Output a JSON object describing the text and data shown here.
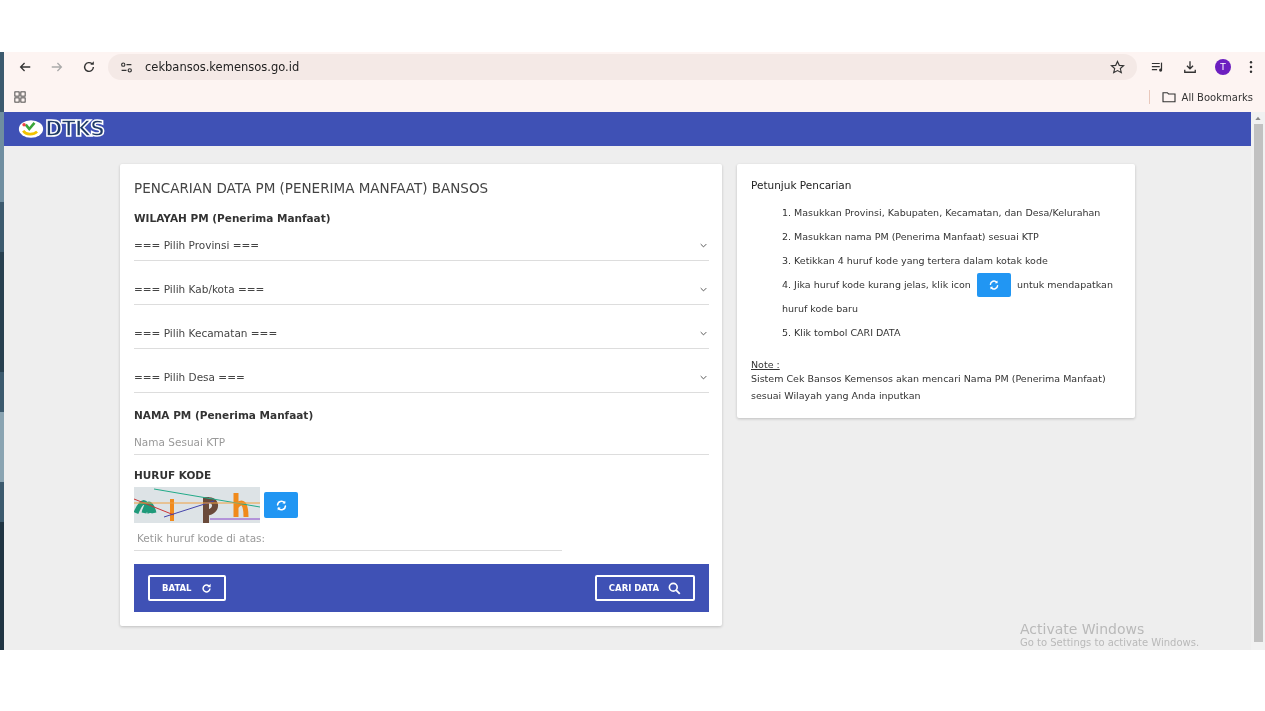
{
  "browser": {
    "url": "cekbansos.kemensos.go.id",
    "profile_initial": "T",
    "bookmarks_label": "All Bookmarks"
  },
  "header": {
    "logo_text": "DTKS"
  },
  "form": {
    "title": "PENCARIAN DATA PM (PENERIMA MANFAAT) BANSOS",
    "region_label": "WILAYAH PM (Penerima Manfaat)",
    "selects": [
      {
        "text": "=== Pilih Provinsi ==="
      },
      {
        "text": "=== Pilih Kab/kota ==="
      },
      {
        "text": "=== Pilih Kecamatan ==="
      },
      {
        "text": "=== Pilih Desa ==="
      }
    ],
    "name_label": "NAMA PM (Penerima Manfaat)",
    "name_field": {
      "placeholder": "Nama Sesuai KTP"
    },
    "code_label": "HURUF KODE",
    "code_field": {
      "placeholder": "Ketik huruf kode di atas:"
    },
    "buttons": [
      {
        "kind": "reset",
        "label": "BATAL"
      },
      {
        "kind": "search",
        "label": "CARI DATA"
      }
    ]
  },
  "help": {
    "title": "Petunjuk Pencarian",
    "steps": [
      {
        "kind": "text",
        "text": "1. Masukkan Provinsi, Kabupaten, Kecamatan, dan Desa/Kelurahan"
      },
      {
        "kind": "text",
        "text": "2. Masukkan nama PM (Penerima Manfaat) sesuai KTP"
      },
      {
        "kind": "text",
        "text": "3. Ketikkan 4 huruf kode yang tertera dalam kotak kode"
      },
      {
        "kind": "icon",
        "text": "4. Jika huruf kode kurang jelas, klik icon",
        "after": "untuk mendapatkan",
        "continuation": "huruf kode baru"
      },
      {
        "kind": "text",
        "text": "5. Klik tombol CARI DATA"
      }
    ],
    "note_label": "Note :",
    "note": "Sistem Cek Bansos Kemensos akan mencari Nama PM (Penerima Manfaat) sesuai Wilayah yang Anda inputkan"
  },
  "os_notice": {
    "title": "Activate Windows",
    "text": "Go to Settings to activate Windows."
  }
}
